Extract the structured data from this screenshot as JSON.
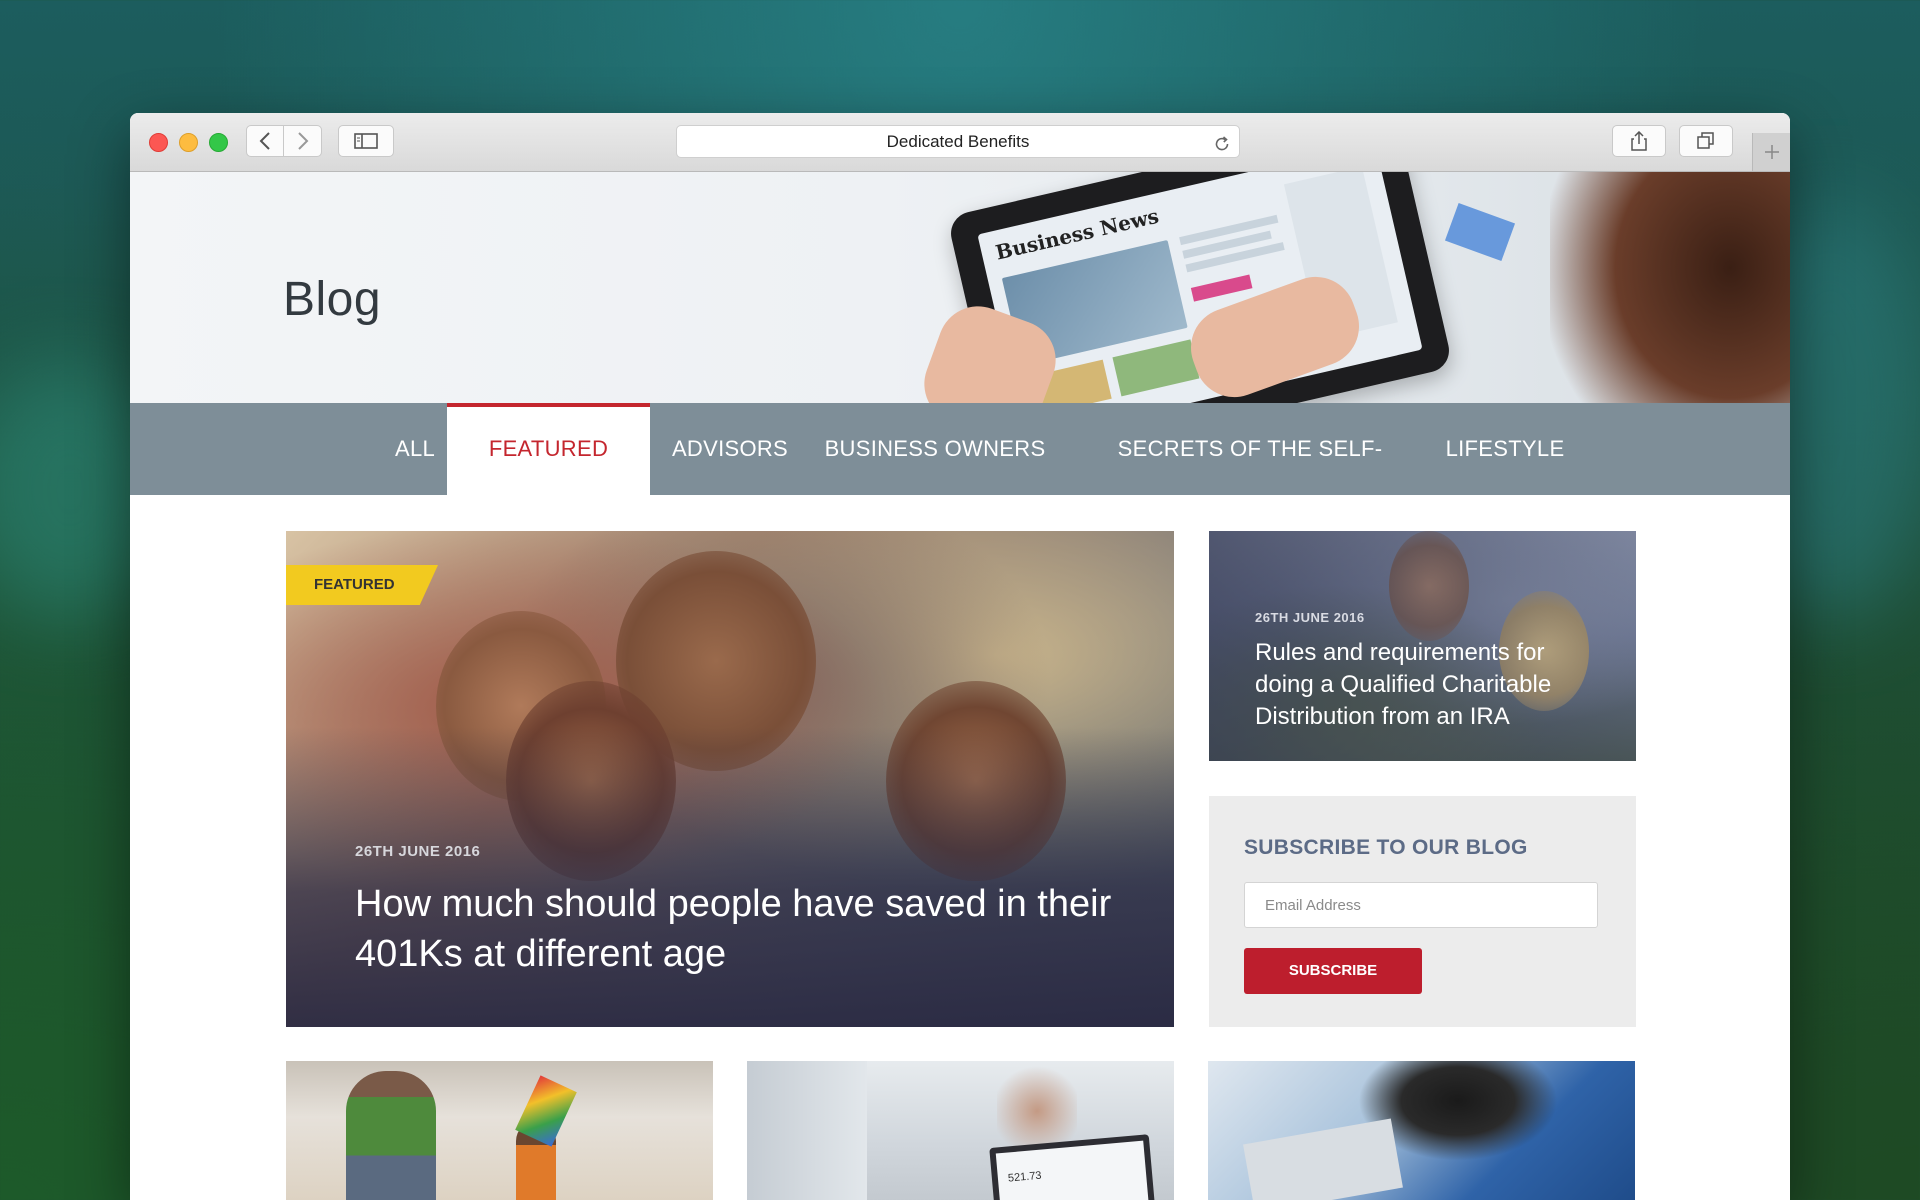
{
  "browser": {
    "address_title": "Dedicated Benefits"
  },
  "hero": {
    "title": "Blog",
    "tablet_headline": "Business News"
  },
  "nav": {
    "items": [
      {
        "label": "ALL",
        "active": false
      },
      {
        "label": "FEATURED",
        "active": true
      },
      {
        "label": "ADVISORS",
        "active": false
      },
      {
        "label": "BUSINESS OWNERS",
        "active": false
      },
      {
        "label": "SECRETS OF THE SELF-MADE",
        "active": false
      },
      {
        "label": "LIFESTYLE",
        "active": false
      }
    ]
  },
  "featured_post": {
    "badge": "FEATURED",
    "date": "26TH JUNE 2016",
    "title": "How much should people have saved in their 401Ks at different age"
  },
  "side_post": {
    "date": "26TH JUNE 2016",
    "title": "Rules and requirements for doing a Qualified Charitable Distribution from an IRA"
  },
  "subscribe": {
    "title": "SUBSCRIBE TO OUR BLOG",
    "email_placeholder": "Email Address",
    "button_label": "SUBSCRIBE"
  },
  "bottom_cards": {
    "laptop_reading": "521.73"
  },
  "colors": {
    "accent_red": "#c4262e",
    "nav_bg": "#7e8e98",
    "badge_yellow": "#f2ca1f",
    "subscribe_button": "#bd1e2d",
    "subscribe_title": "#5c6b86"
  }
}
